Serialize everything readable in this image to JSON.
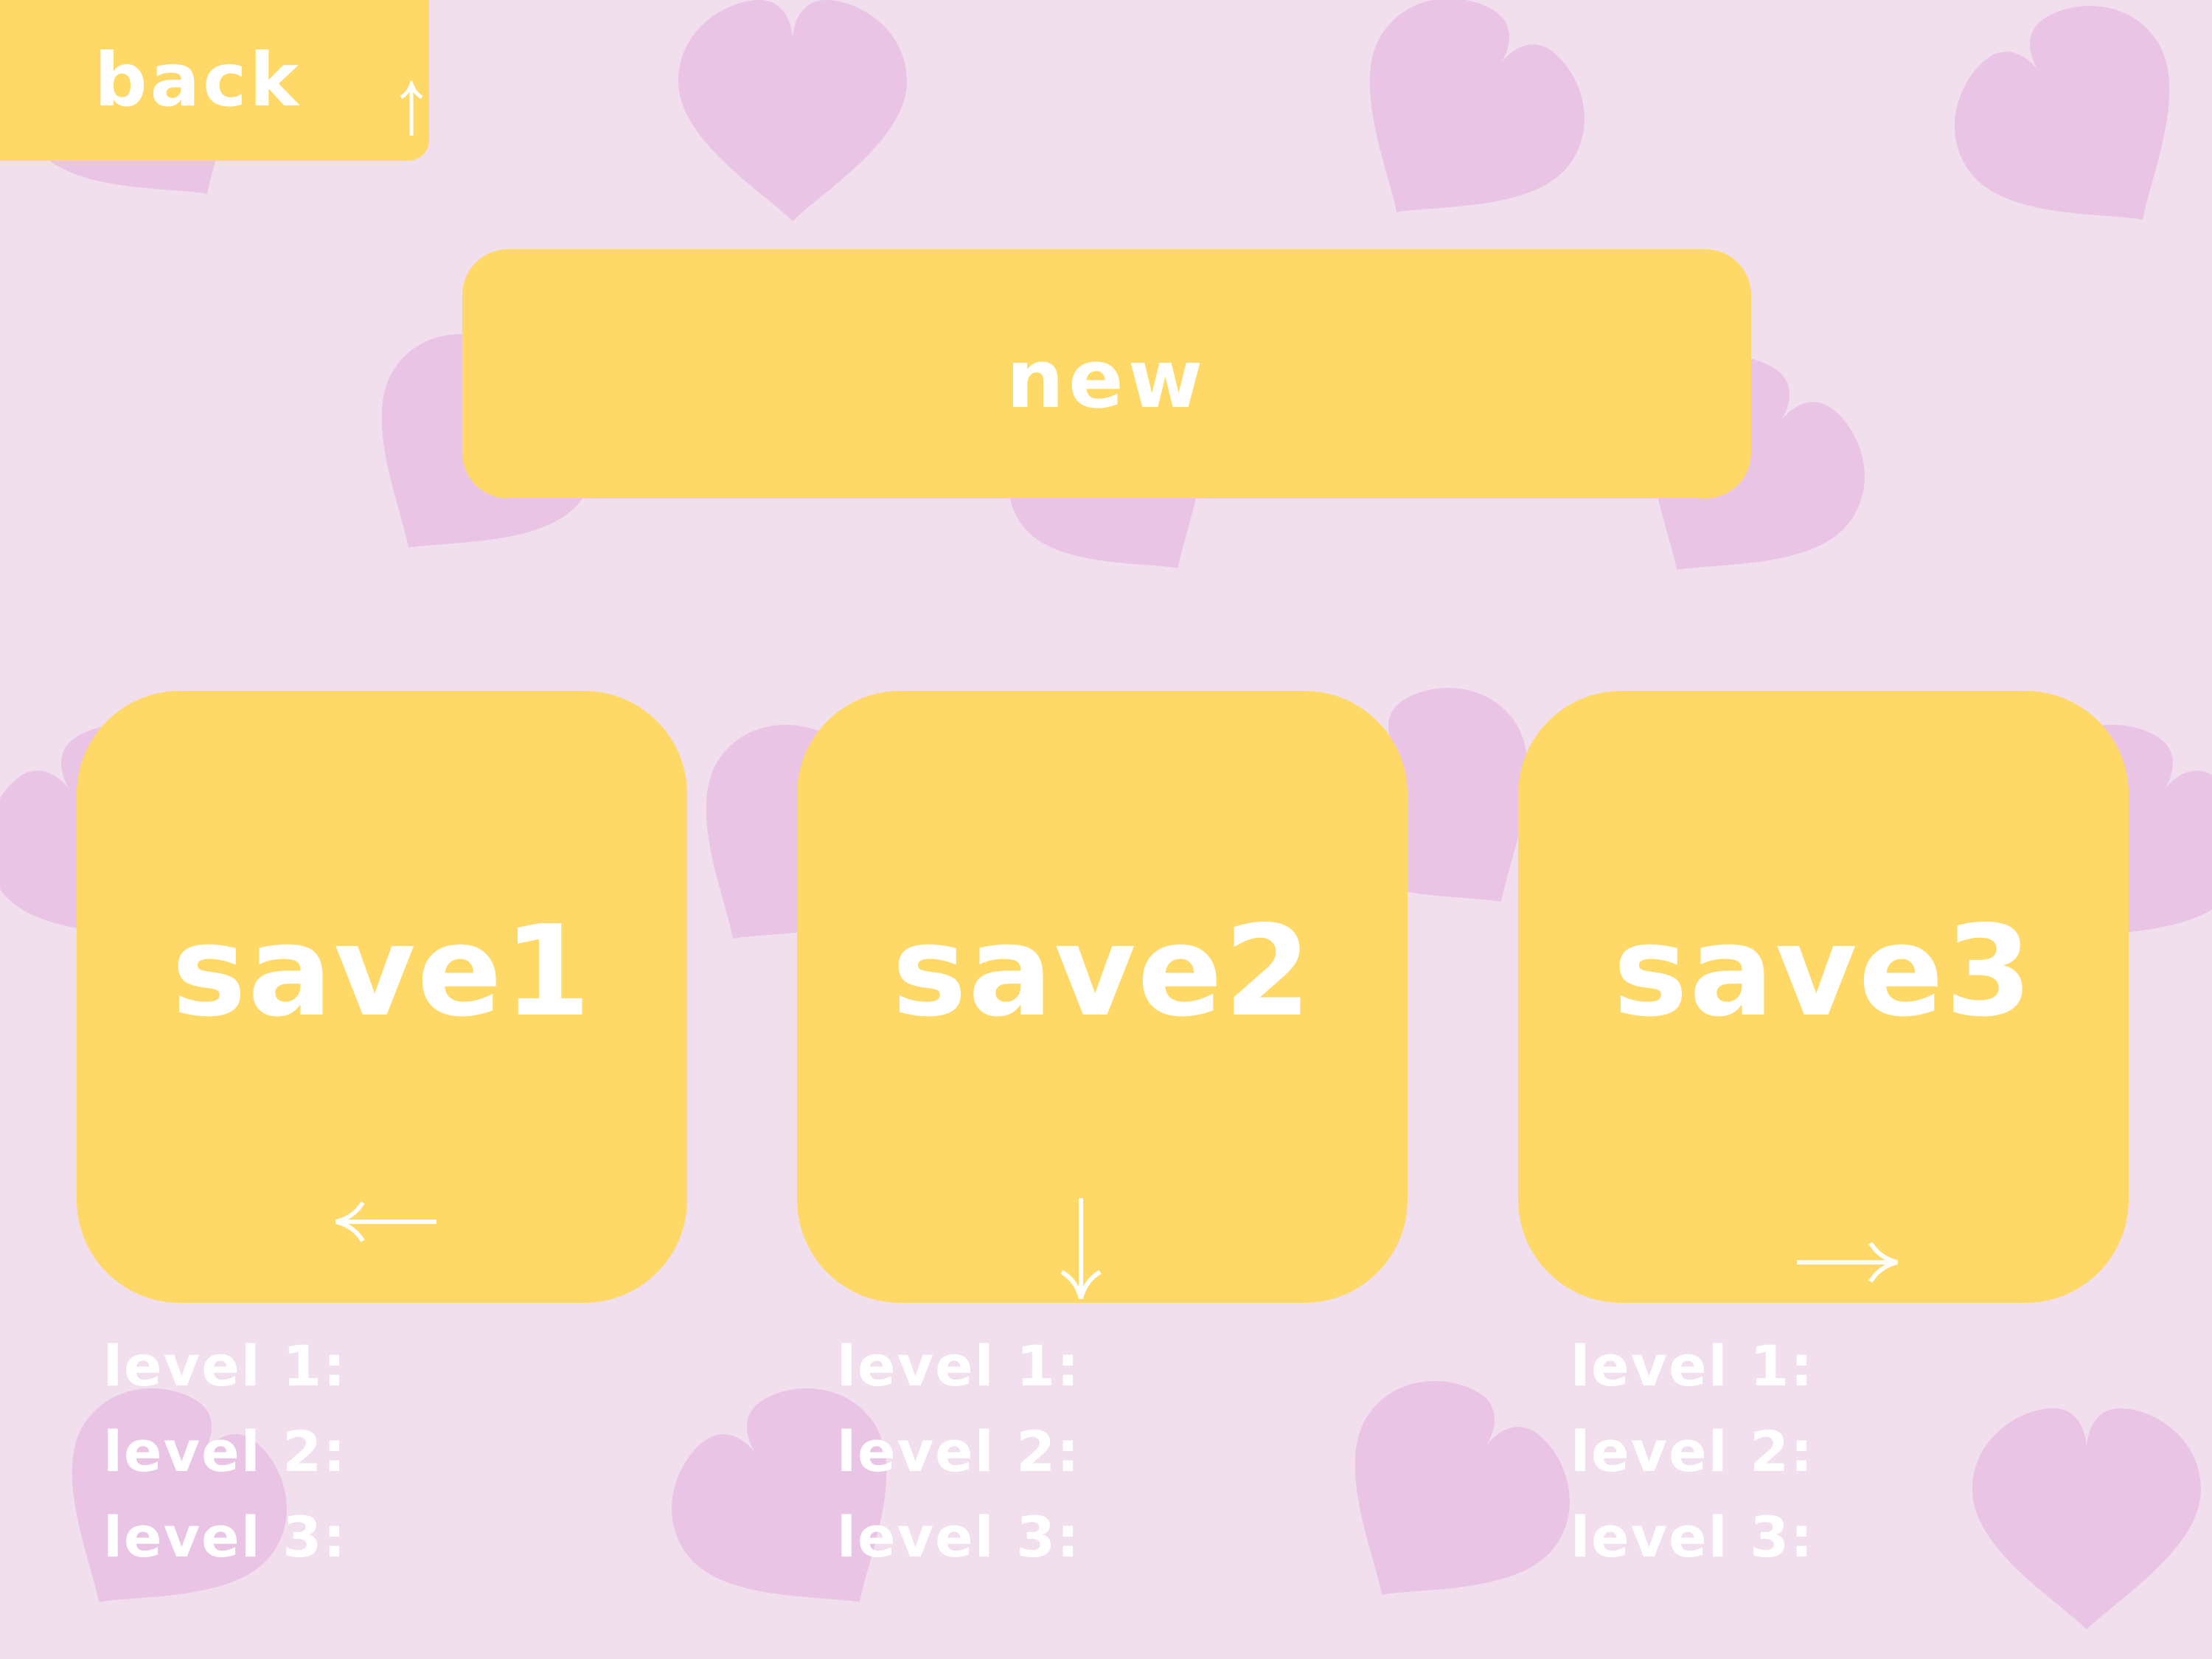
{
  "colors": {
    "background": "#f1dfee",
    "heart": "#e9c4e5",
    "button": "#ffd967",
    "text": "#ffffff"
  },
  "back": {
    "label": "back",
    "icon": "arrow-up-icon"
  },
  "new_game": {
    "label": "new"
  },
  "save_slots": [
    {
      "label": "save1",
      "icon": "arrow-left-icon",
      "levels": [
        "level 1:",
        "level 2:",
        "level 3:"
      ]
    },
    {
      "label": "save2",
      "icon": "arrow-down-icon",
      "levels": [
        "level 1:",
        "level 2:",
        "level 3:"
      ]
    },
    {
      "label": "save3",
      "icon": "arrow-right-icon",
      "levels": [
        "level 1:",
        "level 2:",
        "level 3:"
      ]
    }
  ]
}
